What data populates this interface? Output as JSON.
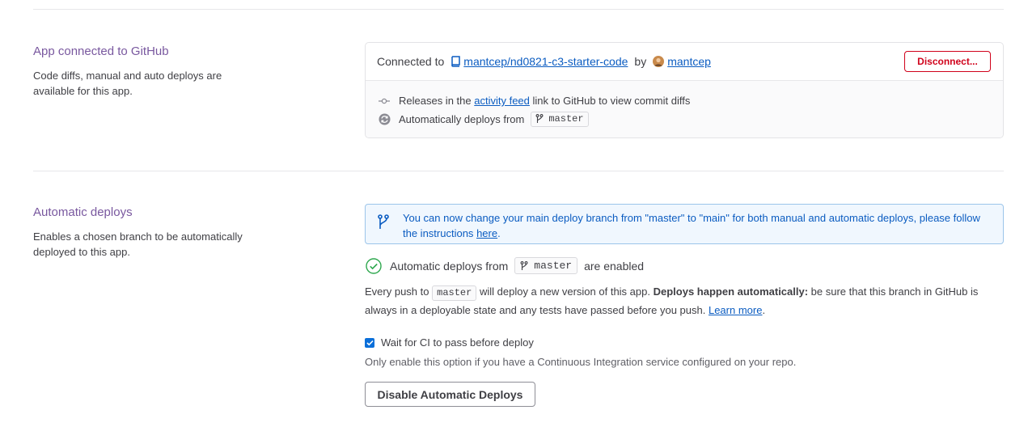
{
  "github": {
    "title": "App connected to GitHub",
    "description": "Code diffs, manual and auto deploys are available for this app.",
    "connected_label": "Connected to",
    "repo": "mantcep/nd0821-c3-starter-code",
    "by_label": "by",
    "user": "mantcep",
    "disconnect_label": "Disconnect...",
    "releases_prefix": "Releases in the",
    "activity_feed_link": "activity feed",
    "releases_suffix": "link to GitHub to view commit diffs",
    "auto_deploys_label": "Automatically deploys from",
    "branch": "master"
  },
  "auto_deploys": {
    "title": "Automatic deploys",
    "description": "Enables a chosen branch to be automatically deployed to this app.",
    "notice_text": "You can now change your main deploy branch from \"master\" to \"main\" for both manual and automatic deploys, please follow the instructions",
    "notice_link": "here",
    "notice_end": ".",
    "status_prefix": "Automatic deploys from",
    "status_branch": "master",
    "status_suffix": "are enabled",
    "para_prefix": "Every push to",
    "para_branch": "master",
    "para_middle": "will deploy a new version of this app.",
    "para_bold": "Deploys happen automatically:",
    "para_rest": "be sure that this branch in GitHub is always in a deployable state and any tests have passed before you push.",
    "learn_more": "Learn more",
    "para_end": ".",
    "ci_label": "Wait for CI to pass before deploy",
    "ci_checked": true,
    "ci_note": "Only enable this option if you have a Continuous Integration service configured on your repo.",
    "disable_label": "Disable Automatic Deploys"
  },
  "colors": {
    "section_title": "#79589f",
    "link": "#0b5cc1",
    "danger": "#d0021b",
    "success": "#2fa84f",
    "notice_bg": "#f0f7fe"
  },
  "icons": [
    "repo-icon",
    "avatar",
    "commit-icon",
    "sync-icon",
    "branch-icon",
    "check-circle-icon",
    "checkbox-check-icon"
  ]
}
